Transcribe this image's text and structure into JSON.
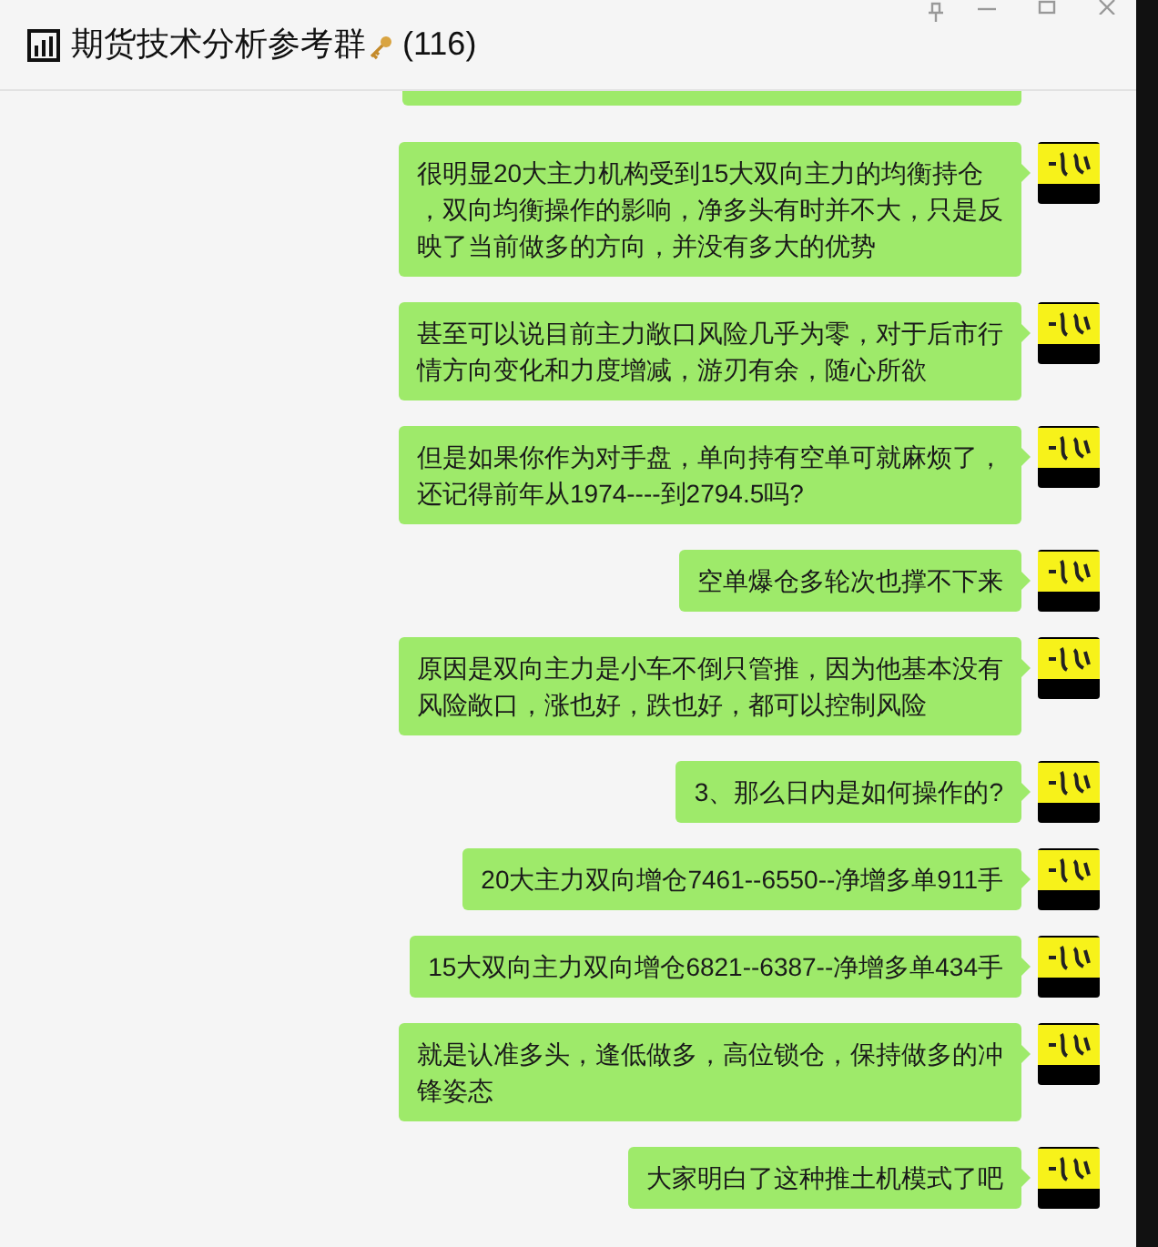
{
  "window": {
    "title": "期货技术分析参考群",
    "member_count": "(116)"
  },
  "messages": [
    {
      "lines": [
        "很明显20大主力机构受到15大双向主力的均衡持仓",
        "，双向均衡操作的影响，净多头有时并不大，只是反",
        "映了当前做多的方向，并没有多大的优势"
      ]
    },
    {
      "lines": [
        "甚至可以说目前主力敞口风险几乎为零，对于后市行",
        "情方向变化和力度增减，游刃有余，随心所欲"
      ]
    },
    {
      "lines": [
        "但是如果你作为对手盘，单向持有空单可就麻烦了，",
        "还记得前年从1974----到2794.5吗?"
      ]
    },
    {
      "lines": [
        "空单爆仓多轮次也撑不下来"
      ]
    },
    {
      "lines": [
        "原因是双向主力是小车不倒只管推，因为他基本没有",
        "风险敞口，涨也好，跌也好，都可以控制风险"
      ]
    },
    {
      "lines": [
        "3、那么日内是如何操作的?"
      ]
    },
    {
      "lines": [
        "20大主力双向增仓7461--6550--净增多单911手"
      ]
    },
    {
      "lines": [
        "15大双向主力双向增仓6821--6387--净增多单434手"
      ]
    },
    {
      "lines": [
        "就是认准多头，逢低做多，高位锁仓，保持做多的冲",
        "锋姿态"
      ]
    },
    {
      "lines": [
        "大家明白了这种推土机模式了吧"
      ]
    }
  ]
}
